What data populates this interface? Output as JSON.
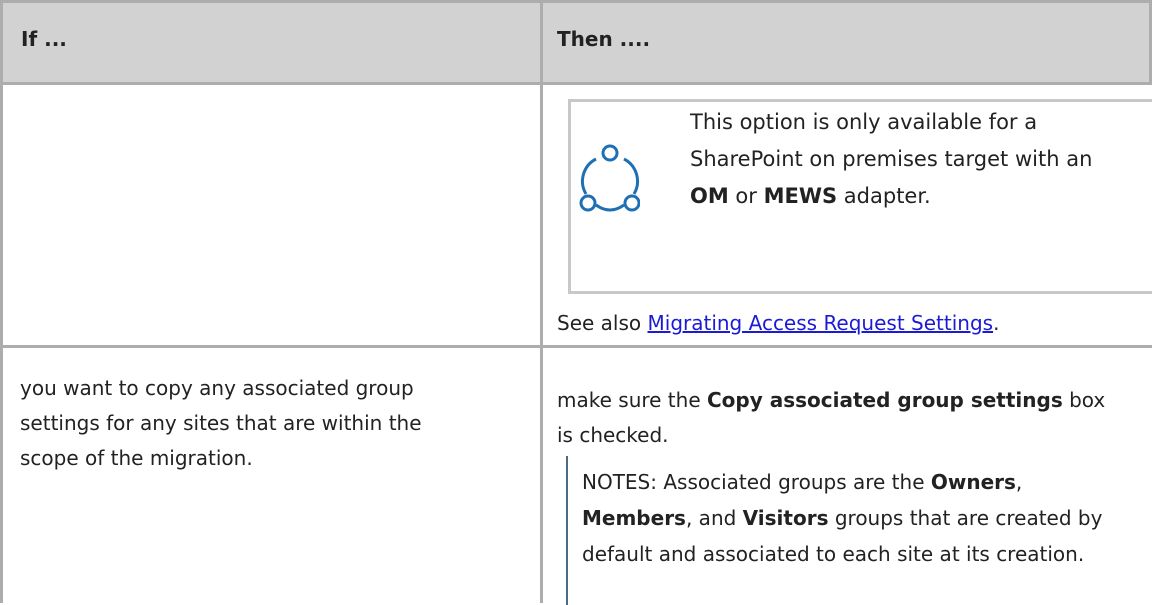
{
  "table": {
    "header": {
      "if": "If ...",
      "then": "Then ...."
    },
    "row1": {
      "note_line1": "This option is only available for a",
      "note_line2": "SharePoint on premises target with an",
      "note_line3_bold1": "OM",
      "note_line3_mid": " or ",
      "note_line3_bold2": "MEWS",
      "note_line3_end": " adapter.",
      "see_also_prefix": "See also ",
      "see_also_link": "Migrating Access Request Settings",
      "see_also_suffix": "."
    },
    "row2": {
      "if_line1": "you want to copy any associated group",
      "if_line2": "settings for any sites that are within the",
      "if_line3": "scope of the migration.",
      "then_line1_prefix": "make sure the ",
      "then_line1_bold": "Copy associated group settings",
      "then_line1_suffix": " box",
      "then_line2": "is checked.",
      "notes_prefix": "NOTES:  Associated groups are the ",
      "notes_bold1": "Owners",
      "notes_comma": ",",
      "notes_bold2": "Members",
      "notes_and": ", and ",
      "notes_bold3": "Visitors",
      "notes_line2_suffix": " groups that are created by",
      "notes_line3": "default and associated to each site at its creation."
    }
  },
  "icon": {
    "name": "share-icon",
    "color": "#1f6fb5"
  },
  "colors": {
    "header_bg": "#d2d2d2",
    "rule": "#adadad",
    "link": "#1b1bd6"
  }
}
